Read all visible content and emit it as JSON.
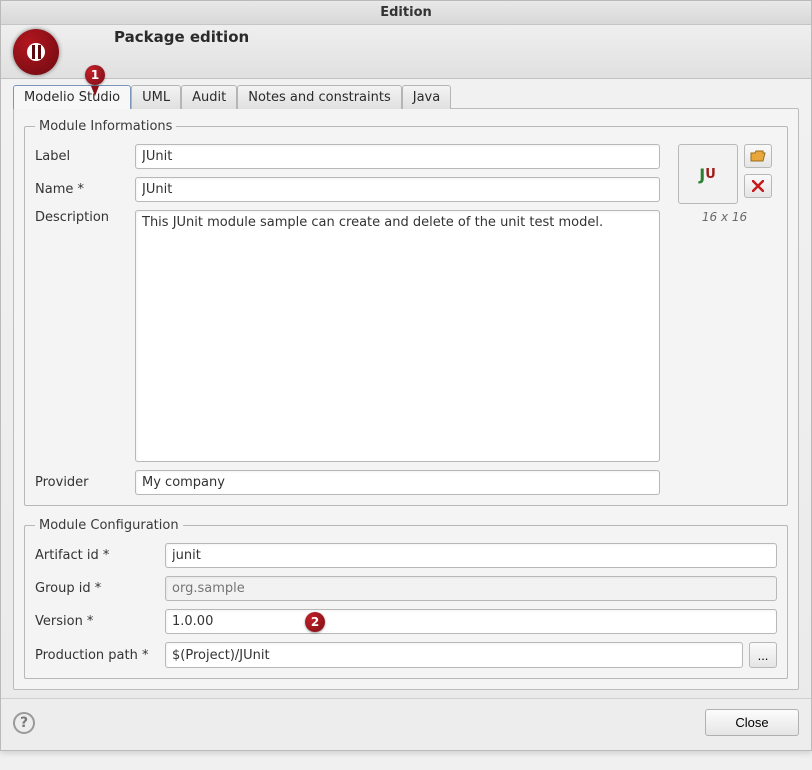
{
  "window": {
    "title": "Edition"
  },
  "header": {
    "title": "Package edition"
  },
  "tabs": [
    {
      "label": "Modelio Studio"
    },
    {
      "label": "UML"
    },
    {
      "label": "Audit"
    },
    {
      "label": "Notes and constraints"
    },
    {
      "label": "Java"
    }
  ],
  "info_group": {
    "legend": "Module Informations",
    "label_lbl": "Label",
    "label_val": "JUnit",
    "name_lbl": "Name *",
    "name_val": "JUnit",
    "desc_lbl": "Description",
    "desc_val": "This JUnit module sample can create and delete of the unit test model.",
    "provider_lbl": "Provider",
    "provider_val": "My company",
    "preview_text_j": "J",
    "preview_text_u": "U",
    "preview_caption": "16 x 16"
  },
  "config_group": {
    "legend": "Module Configuration",
    "artifact_lbl": "Artifact id *",
    "artifact_val": "junit",
    "group_lbl": "Group id *",
    "group_placeholder": "org.sample",
    "group_val": "",
    "version_lbl": "Version *",
    "version_val": "1.0.00",
    "prodpath_lbl": "Production path *",
    "prodpath_val": "$(Project)/JUnit",
    "browse_label": "..."
  },
  "callouts": {
    "one": "1",
    "two": "2"
  },
  "footer": {
    "help": "?",
    "close": "Close"
  }
}
